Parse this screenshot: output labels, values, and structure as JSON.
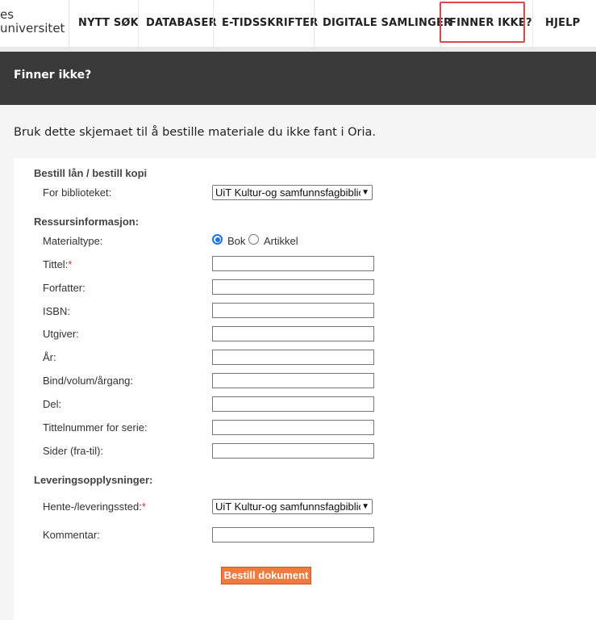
{
  "logo": {
    "line1": "es",
    "line2": "universitet"
  },
  "nav": {
    "items": [
      {
        "label": "NYTT SØK"
      },
      {
        "label": "DATABASER"
      },
      {
        "label": "E-TIDSSKRIFTER"
      },
      {
        "label": "DIGITALE SAMLINGER"
      },
      {
        "label": "FINNER IKKE?"
      },
      {
        "label": "HJELP"
      }
    ],
    "active_highlight_color": "#e0474c"
  },
  "page": {
    "title": "Finner ikke?",
    "intro": "Bruk dette skjemaet til å bestille materiale du ikke fant i Oria."
  },
  "form": {
    "section_order": "Bestill lån / bestill kopi",
    "library_label": "For biblioteket:",
    "library_value": "UiT Kultur-og samfunnsfagbibliotek",
    "section_resource": "Ressursinformasjon:",
    "material_type_label": "Materialtype:",
    "material_options": [
      "Bok",
      "Artikkel"
    ],
    "material_selected": "Bok",
    "fields": [
      {
        "label": "Tittel:",
        "required": "*",
        "value": ""
      },
      {
        "label": "Forfatter:",
        "required": "",
        "value": ""
      },
      {
        "label": "ISBN:",
        "required": "",
        "value": ""
      },
      {
        "label": "Utgiver:",
        "required": "",
        "value": ""
      },
      {
        "label": "År:",
        "required": "",
        "value": ""
      },
      {
        "label": "Bind/volum/årgang:",
        "required": "",
        "value": ""
      },
      {
        "label": "Del:",
        "required": "",
        "value": ""
      },
      {
        "label": "Tittelnummer for serie:",
        "required": "",
        "value": ""
      },
      {
        "label": "Sider (fra-til):",
        "required": "",
        "value": ""
      }
    ],
    "section_delivery": "Leveringsopplysninger:",
    "pickup_label": "Hente-/leveringssted:",
    "pickup_required": "*",
    "pickup_value": "UiT Kultur-og samfunnsfagbibliotek",
    "comment_label": "Kommentar:",
    "comment_value": "",
    "submit_label": "Bestill dokument"
  },
  "colors": {
    "header_bar": "#3a3a3a",
    "submit": "#f07b3f",
    "radio_accent": "#1a73e8"
  }
}
